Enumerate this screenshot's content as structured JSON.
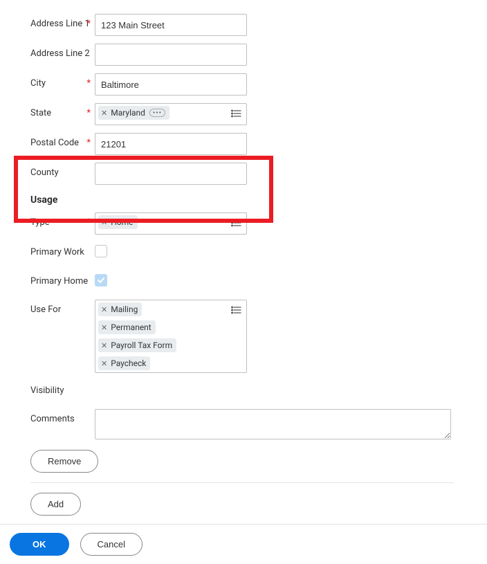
{
  "address": {
    "line1_label": "Address Line 1",
    "line1_value": "123 Main Street",
    "line2_label": "Address Line 2",
    "line2_value": "",
    "city_label": "City",
    "city_value": "Baltimore",
    "state_label": "State",
    "state_chip": "Maryland",
    "postal_label": "Postal Code",
    "postal_value": "21201",
    "county_label": "County",
    "county_value": ""
  },
  "usage": {
    "heading": "Usage",
    "type_label": "Type",
    "type_chip": "Home",
    "primary_work_label": "Primary Work",
    "primary_home_label": "Primary Home",
    "use_for_label": "Use For",
    "use_for_chips": {
      "0": "Mailing",
      "1": "Permanent",
      "2": "Payroll Tax Form",
      "3": "Paycheck"
    },
    "visibility_label": "Visibility",
    "comments_label": "Comments"
  },
  "buttons": {
    "remove": "Remove",
    "add": "Add",
    "ok": "OK",
    "cancel": "Cancel"
  }
}
